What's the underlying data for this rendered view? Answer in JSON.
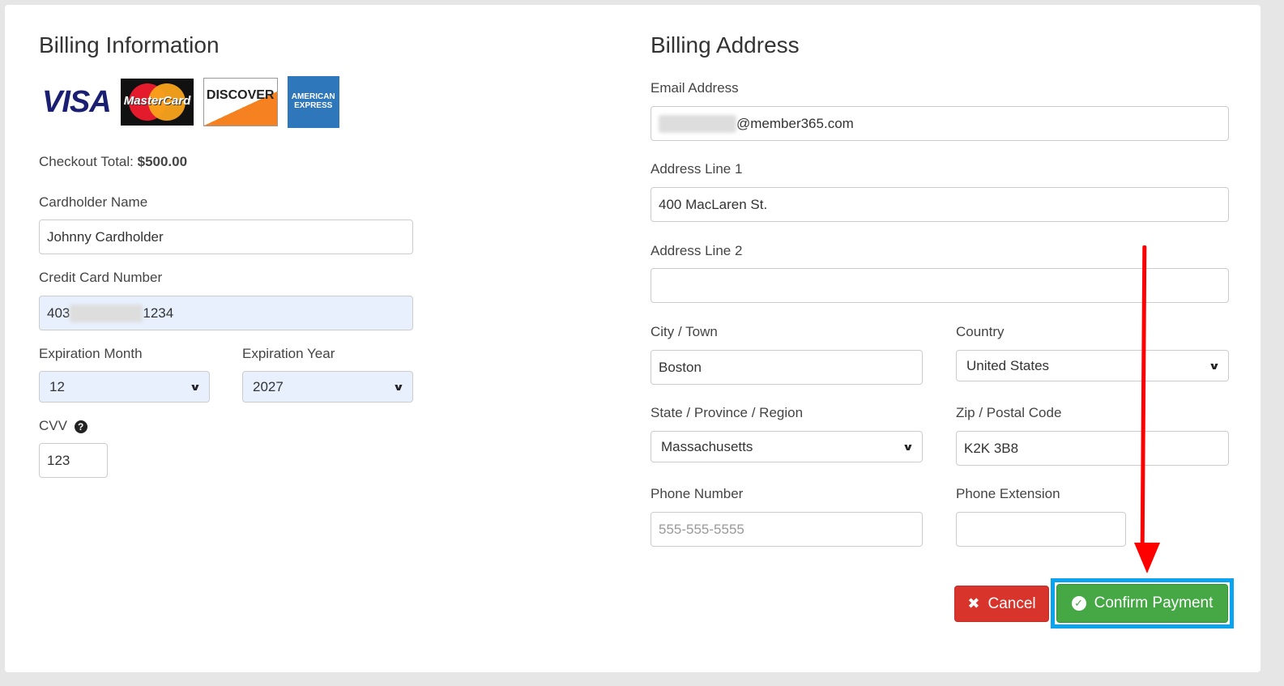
{
  "billing_info": {
    "title": "Billing Information",
    "card_logos": {
      "visa": "VISA",
      "mastercard": "MasterCard",
      "discover": "DISCOVER",
      "amex_line1": "AMERICAN",
      "amex_line2": "EXPRESS"
    },
    "checkout_total_label": "Checkout Total:",
    "checkout_total_value": "$500.00",
    "cardholder_label": "Cardholder Name",
    "cardholder_value": "Johnny Cardholder",
    "card_number_label": "Credit Card Number",
    "card_number_prefix": "403",
    "card_number_suffix": "1234",
    "exp_month_label": "Expiration Month",
    "exp_month_value": "12",
    "exp_year_label": "Expiration Year",
    "exp_year_value": "2027",
    "cvv_label": "CVV",
    "cvv_value": "123"
  },
  "billing_address": {
    "title": "Billing Address",
    "email_label": "Email Address",
    "email_value_suffix": "@member365.com",
    "address1_label": "Address Line 1",
    "address1_value": "400 MacLaren St.",
    "address2_label": "Address Line 2",
    "address2_value": "",
    "city_label": "City / Town",
    "city_value": "Boston",
    "country_label": "Country",
    "country_value": "United States",
    "state_label": "State / Province / Region",
    "state_value": "Massachusetts",
    "zip_label": "Zip / Postal Code",
    "zip_value": "K2K 3B8",
    "phone_label": "Phone Number",
    "phone_placeholder": "555-555-5555",
    "ext_label": "Phone Extension",
    "ext_value": ""
  },
  "actions": {
    "cancel_label": "Cancel",
    "confirm_label": "Confirm Payment"
  },
  "colors": {
    "cancel": "#d9342b",
    "confirm": "#45a845",
    "highlight_outline": "#0aa3ee",
    "annotation_arrow": "#ff0000",
    "autofill_bg": "#e8f0fe"
  }
}
